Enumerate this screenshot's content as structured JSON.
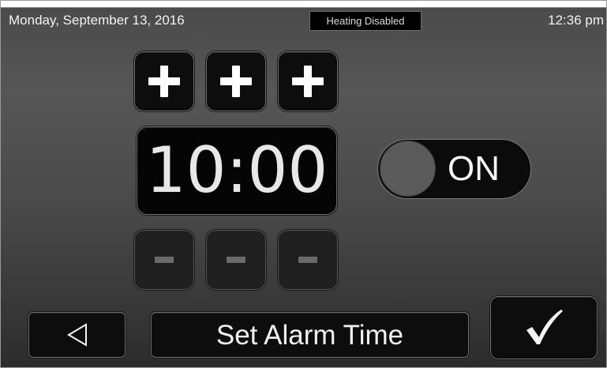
{
  "status_bar": {
    "date": "Monday, September 13, 2016",
    "heating_status": "Heating Disabled",
    "time": "12:36 pm"
  },
  "alarm": {
    "time": "10:00",
    "toggle_state": "ON"
  },
  "footer": {
    "title": "Set Alarm Time",
    "back_icon": "back-triangle-icon",
    "confirm_icon": "checkmark-icon"
  },
  "colors": {
    "tile": "#0d0d0d",
    "text": "#ffffff",
    "disabled_minus": "#6a6a6a"
  }
}
